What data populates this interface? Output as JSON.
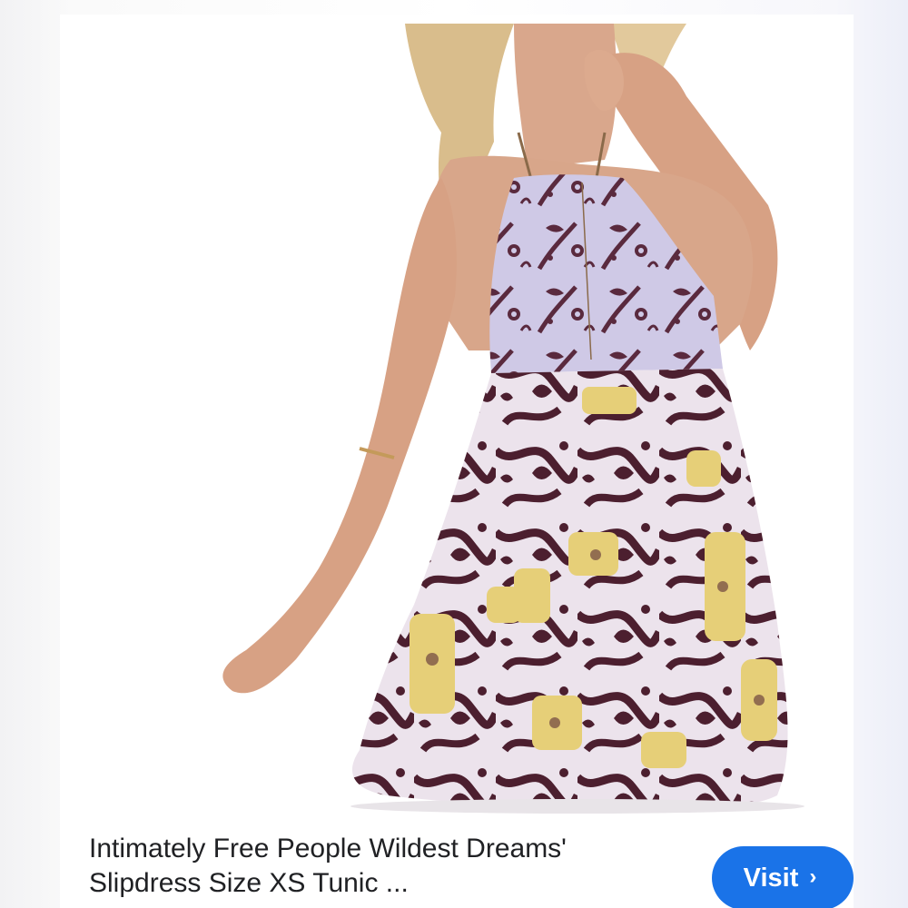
{
  "product": {
    "image_alt": "Model wearing a floral halter slip dress",
    "title_line1": "Intimately Free People Wildest Dreams'",
    "title_line2": "Slipdress Size XS Tunic ..."
  },
  "actions": {
    "visit_label": "Visit",
    "visit_icon": "chevron-right-icon",
    "accent_color": "#1a73e8"
  }
}
